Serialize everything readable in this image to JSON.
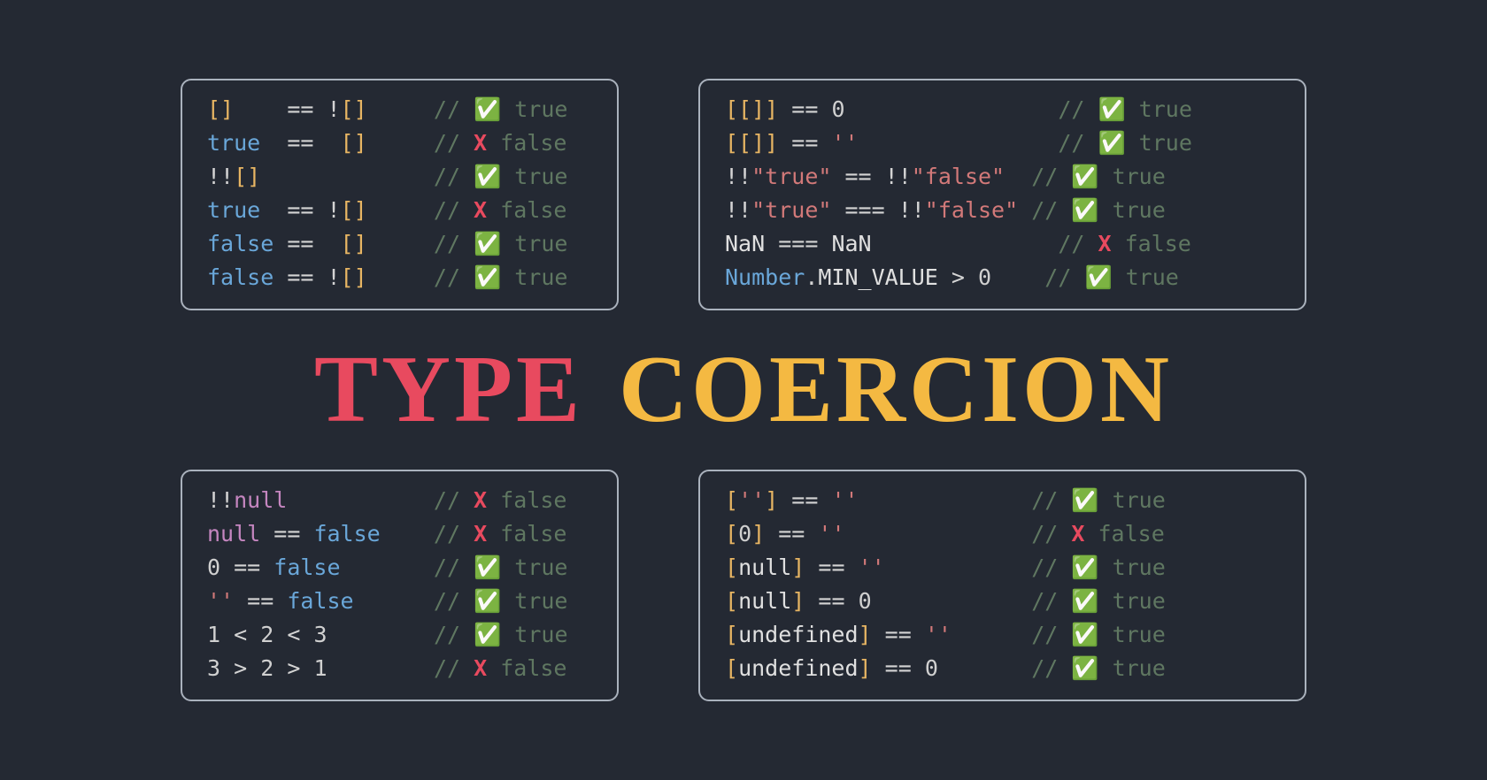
{
  "title": {
    "word1": "TYPE",
    "word2": "COERCION"
  },
  "boxes": {
    "top_left": [
      {
        "tokens": [
          {
            "class": "tk-bracket",
            "text": "[]    "
          },
          {
            "class": "tk-equals",
            "text": "=="
          },
          {
            "class": "tk-op",
            "text": " !"
          },
          {
            "class": "tk-bracket",
            "text": "[]     "
          },
          {
            "class": "tk-comment",
            "text": "// "
          },
          {
            "class": "tk-check",
            "text": "✅"
          },
          {
            "class": "tk-result",
            "text": " true"
          }
        ]
      },
      {
        "tokens": [
          {
            "class": "tk-bool",
            "text": "true  "
          },
          {
            "class": "tk-equals",
            "text": "=="
          },
          {
            "class": "tk-op",
            "text": "  "
          },
          {
            "class": "tk-bracket",
            "text": "[]     "
          },
          {
            "class": "tk-comment",
            "text": "// "
          },
          {
            "class": "tk-cross",
            "text": "X"
          },
          {
            "class": "tk-result",
            "text": " false"
          }
        ]
      },
      {
        "tokens": [
          {
            "class": "tk-op",
            "text": "!!"
          },
          {
            "class": "tk-bracket",
            "text": "[]             "
          },
          {
            "class": "tk-comment",
            "text": "// "
          },
          {
            "class": "tk-check",
            "text": "✅"
          },
          {
            "class": "tk-result",
            "text": " true"
          }
        ]
      },
      {
        "tokens": [
          {
            "class": "tk-bool",
            "text": "true  "
          },
          {
            "class": "tk-equals",
            "text": "=="
          },
          {
            "class": "tk-op",
            "text": " !"
          },
          {
            "class": "tk-bracket",
            "text": "[]     "
          },
          {
            "class": "tk-comment",
            "text": "// "
          },
          {
            "class": "tk-cross",
            "text": "X"
          },
          {
            "class": "tk-result",
            "text": " false"
          }
        ]
      },
      {
        "tokens": [
          {
            "class": "tk-bool",
            "text": "false "
          },
          {
            "class": "tk-equals",
            "text": "=="
          },
          {
            "class": "tk-op",
            "text": "  "
          },
          {
            "class": "tk-bracket",
            "text": "[]     "
          },
          {
            "class": "tk-comment",
            "text": "// "
          },
          {
            "class": "tk-check",
            "text": "✅"
          },
          {
            "class": "tk-result",
            "text": " true"
          }
        ]
      },
      {
        "tokens": [
          {
            "class": "tk-bool",
            "text": "false "
          },
          {
            "class": "tk-equals",
            "text": "=="
          },
          {
            "class": "tk-op",
            "text": " !"
          },
          {
            "class": "tk-bracket",
            "text": "[]     "
          },
          {
            "class": "tk-comment",
            "text": "// "
          },
          {
            "class": "tk-check",
            "text": "✅"
          },
          {
            "class": "tk-result",
            "text": " true"
          }
        ]
      }
    ],
    "top_right": [
      {
        "tokens": [
          {
            "class": "tk-bracket",
            "text": "[[]] "
          },
          {
            "class": "tk-equals",
            "text": "=="
          },
          {
            "class": "tk-op",
            "text": " "
          },
          {
            "class": "tk-num",
            "text": "0                "
          },
          {
            "class": "tk-comment",
            "text": "// "
          },
          {
            "class": "tk-check",
            "text": "✅"
          },
          {
            "class": "tk-result",
            "text": " true"
          }
        ]
      },
      {
        "tokens": [
          {
            "class": "tk-bracket",
            "text": "[[]] "
          },
          {
            "class": "tk-equals",
            "text": "=="
          },
          {
            "class": "tk-op",
            "text": " "
          },
          {
            "class": "tk-str",
            "text": "''               "
          },
          {
            "class": "tk-comment",
            "text": "// "
          },
          {
            "class": "tk-check",
            "text": "✅"
          },
          {
            "class": "tk-result",
            "text": " true"
          }
        ]
      },
      {
        "tokens": [
          {
            "class": "tk-op",
            "text": "!!"
          },
          {
            "class": "tk-str",
            "text": "\"true\""
          },
          {
            "class": "tk-op",
            "text": " "
          },
          {
            "class": "tk-equals",
            "text": "=="
          },
          {
            "class": "tk-op",
            "text": " !!"
          },
          {
            "class": "tk-str",
            "text": "\"false\"  "
          },
          {
            "class": "tk-comment",
            "text": "// "
          },
          {
            "class": "tk-check",
            "text": "✅"
          },
          {
            "class": "tk-result",
            "text": " true"
          }
        ]
      },
      {
        "tokens": [
          {
            "class": "tk-op",
            "text": "!!"
          },
          {
            "class": "tk-str",
            "text": "\"true\""
          },
          {
            "class": "tk-op",
            "text": " "
          },
          {
            "class": "tk-equals",
            "text": "==="
          },
          {
            "class": "tk-op",
            "text": " !!"
          },
          {
            "class": "tk-str",
            "text": "\"false\" "
          },
          {
            "class": "tk-comment",
            "text": "// "
          },
          {
            "class": "tk-check",
            "text": "✅"
          },
          {
            "class": "tk-result",
            "text": " true"
          }
        ]
      },
      {
        "tokens": [
          {
            "class": "tk-nan",
            "text": "NaN "
          },
          {
            "class": "tk-equals",
            "text": "==="
          },
          {
            "class": "tk-op",
            "text": " "
          },
          {
            "class": "tk-nan",
            "text": "NaN              "
          },
          {
            "class": "tk-comment",
            "text": "// "
          },
          {
            "class": "tk-cross",
            "text": "X"
          },
          {
            "class": "tk-result",
            "text": " false"
          }
        ]
      },
      {
        "tokens": [
          {
            "class": "tk-bool",
            "text": "Number"
          },
          {
            "class": "tk-op",
            "text": "."
          },
          {
            "class": "tk-prop",
            "text": "MIN_VALUE "
          },
          {
            "class": "tk-equals",
            "text": ">"
          },
          {
            "class": "tk-op",
            "text": " "
          },
          {
            "class": "tk-num",
            "text": "0    "
          },
          {
            "class": "tk-comment",
            "text": "// "
          },
          {
            "class": "tk-check",
            "text": "✅"
          },
          {
            "class": "tk-result",
            "text": " true"
          }
        ]
      }
    ],
    "bottom_left": [
      {
        "tokens": [
          {
            "class": "tk-op",
            "text": "!!"
          },
          {
            "class": "tk-kw",
            "text": "null           "
          },
          {
            "class": "tk-comment",
            "text": "// "
          },
          {
            "class": "tk-cross",
            "text": "X"
          },
          {
            "class": "tk-result",
            "text": " false"
          }
        ]
      },
      {
        "tokens": [
          {
            "class": "tk-kw",
            "text": "null "
          },
          {
            "class": "tk-equals",
            "text": "=="
          },
          {
            "class": "tk-op",
            "text": " "
          },
          {
            "class": "tk-bool",
            "text": "false    "
          },
          {
            "class": "tk-comment",
            "text": "// "
          },
          {
            "class": "tk-cross",
            "text": "X"
          },
          {
            "class": "tk-result",
            "text": " false"
          }
        ]
      },
      {
        "tokens": [
          {
            "class": "tk-num",
            "text": "0 "
          },
          {
            "class": "tk-equals",
            "text": "=="
          },
          {
            "class": "tk-op",
            "text": " "
          },
          {
            "class": "tk-bool",
            "text": "false       "
          },
          {
            "class": "tk-comment",
            "text": "// "
          },
          {
            "class": "tk-check",
            "text": "✅"
          },
          {
            "class": "tk-result",
            "text": " true"
          }
        ]
      },
      {
        "tokens": [
          {
            "class": "tk-str",
            "text": "'' "
          },
          {
            "class": "tk-equals",
            "text": "=="
          },
          {
            "class": "tk-op",
            "text": " "
          },
          {
            "class": "tk-bool",
            "text": "false      "
          },
          {
            "class": "tk-comment",
            "text": "// "
          },
          {
            "class": "tk-check",
            "text": "✅"
          },
          {
            "class": "tk-result",
            "text": " true"
          }
        ]
      },
      {
        "tokens": [
          {
            "class": "tk-num",
            "text": "1 "
          },
          {
            "class": "tk-equals",
            "text": "<"
          },
          {
            "class": "tk-op",
            "text": " "
          },
          {
            "class": "tk-num",
            "text": "2 "
          },
          {
            "class": "tk-equals",
            "text": "<"
          },
          {
            "class": "tk-op",
            "text": " "
          },
          {
            "class": "tk-num",
            "text": "3        "
          },
          {
            "class": "tk-comment",
            "text": "// "
          },
          {
            "class": "tk-check",
            "text": "✅"
          },
          {
            "class": "tk-result",
            "text": " true"
          }
        ]
      },
      {
        "tokens": [
          {
            "class": "tk-num",
            "text": "3 "
          },
          {
            "class": "tk-equals",
            "text": ">"
          },
          {
            "class": "tk-op",
            "text": " "
          },
          {
            "class": "tk-num",
            "text": "2 "
          },
          {
            "class": "tk-equals",
            "text": ">"
          },
          {
            "class": "tk-op",
            "text": " "
          },
          {
            "class": "tk-num",
            "text": "1        "
          },
          {
            "class": "tk-comment",
            "text": "// "
          },
          {
            "class": "tk-cross",
            "text": "X"
          },
          {
            "class": "tk-result",
            "text": " false"
          }
        ]
      }
    ],
    "bottom_right": [
      {
        "tokens": [
          {
            "class": "tk-bracket",
            "text": "["
          },
          {
            "class": "tk-str",
            "text": "''"
          },
          {
            "class": "tk-bracket",
            "text": "] "
          },
          {
            "class": "tk-equals",
            "text": "=="
          },
          {
            "class": "tk-op",
            "text": " "
          },
          {
            "class": "tk-str",
            "text": "''             "
          },
          {
            "class": "tk-comment",
            "text": "// "
          },
          {
            "class": "tk-check",
            "text": "✅"
          },
          {
            "class": "tk-result",
            "text": " true"
          }
        ]
      },
      {
        "tokens": [
          {
            "class": "tk-bracket",
            "text": "["
          },
          {
            "class": "tk-num",
            "text": "0"
          },
          {
            "class": "tk-bracket",
            "text": "] "
          },
          {
            "class": "tk-equals",
            "text": "=="
          },
          {
            "class": "tk-op",
            "text": " "
          },
          {
            "class": "tk-str",
            "text": "''              "
          },
          {
            "class": "tk-comment",
            "text": "// "
          },
          {
            "class": "tk-cross",
            "text": "X"
          },
          {
            "class": "tk-result",
            "text": " false"
          }
        ]
      },
      {
        "tokens": [
          {
            "class": "tk-bracket",
            "text": "["
          },
          {
            "class": "tk-null2",
            "text": "null"
          },
          {
            "class": "tk-bracket",
            "text": "] "
          },
          {
            "class": "tk-equals",
            "text": "=="
          },
          {
            "class": "tk-op",
            "text": " "
          },
          {
            "class": "tk-str",
            "text": "''           "
          },
          {
            "class": "tk-comment",
            "text": "// "
          },
          {
            "class": "tk-check",
            "text": "✅"
          },
          {
            "class": "tk-result",
            "text": " true"
          }
        ]
      },
      {
        "tokens": [
          {
            "class": "tk-bracket",
            "text": "["
          },
          {
            "class": "tk-null2",
            "text": "null"
          },
          {
            "class": "tk-bracket",
            "text": "] "
          },
          {
            "class": "tk-equals",
            "text": "=="
          },
          {
            "class": "tk-op",
            "text": " "
          },
          {
            "class": "tk-num",
            "text": "0            "
          },
          {
            "class": "tk-comment",
            "text": "// "
          },
          {
            "class": "tk-check",
            "text": "✅"
          },
          {
            "class": "tk-result",
            "text": " true"
          }
        ]
      },
      {
        "tokens": [
          {
            "class": "tk-bracket",
            "text": "["
          },
          {
            "class": "tk-undef",
            "text": "undefined"
          },
          {
            "class": "tk-bracket",
            "text": "] "
          },
          {
            "class": "tk-equals",
            "text": "=="
          },
          {
            "class": "tk-op",
            "text": " "
          },
          {
            "class": "tk-str",
            "text": "''      "
          },
          {
            "class": "tk-comment",
            "text": "// "
          },
          {
            "class": "tk-check",
            "text": "✅"
          },
          {
            "class": "tk-result",
            "text": " true"
          }
        ]
      },
      {
        "tokens": [
          {
            "class": "tk-bracket",
            "text": "["
          },
          {
            "class": "tk-undef",
            "text": "undefined"
          },
          {
            "class": "tk-bracket",
            "text": "] "
          },
          {
            "class": "tk-equals",
            "text": "=="
          },
          {
            "class": "tk-op",
            "text": " "
          },
          {
            "class": "tk-num",
            "text": "0       "
          },
          {
            "class": "tk-comment",
            "text": "// "
          },
          {
            "class": "tk-check",
            "text": "✅"
          },
          {
            "class": "tk-result",
            "text": " true"
          }
        ]
      }
    ]
  }
}
